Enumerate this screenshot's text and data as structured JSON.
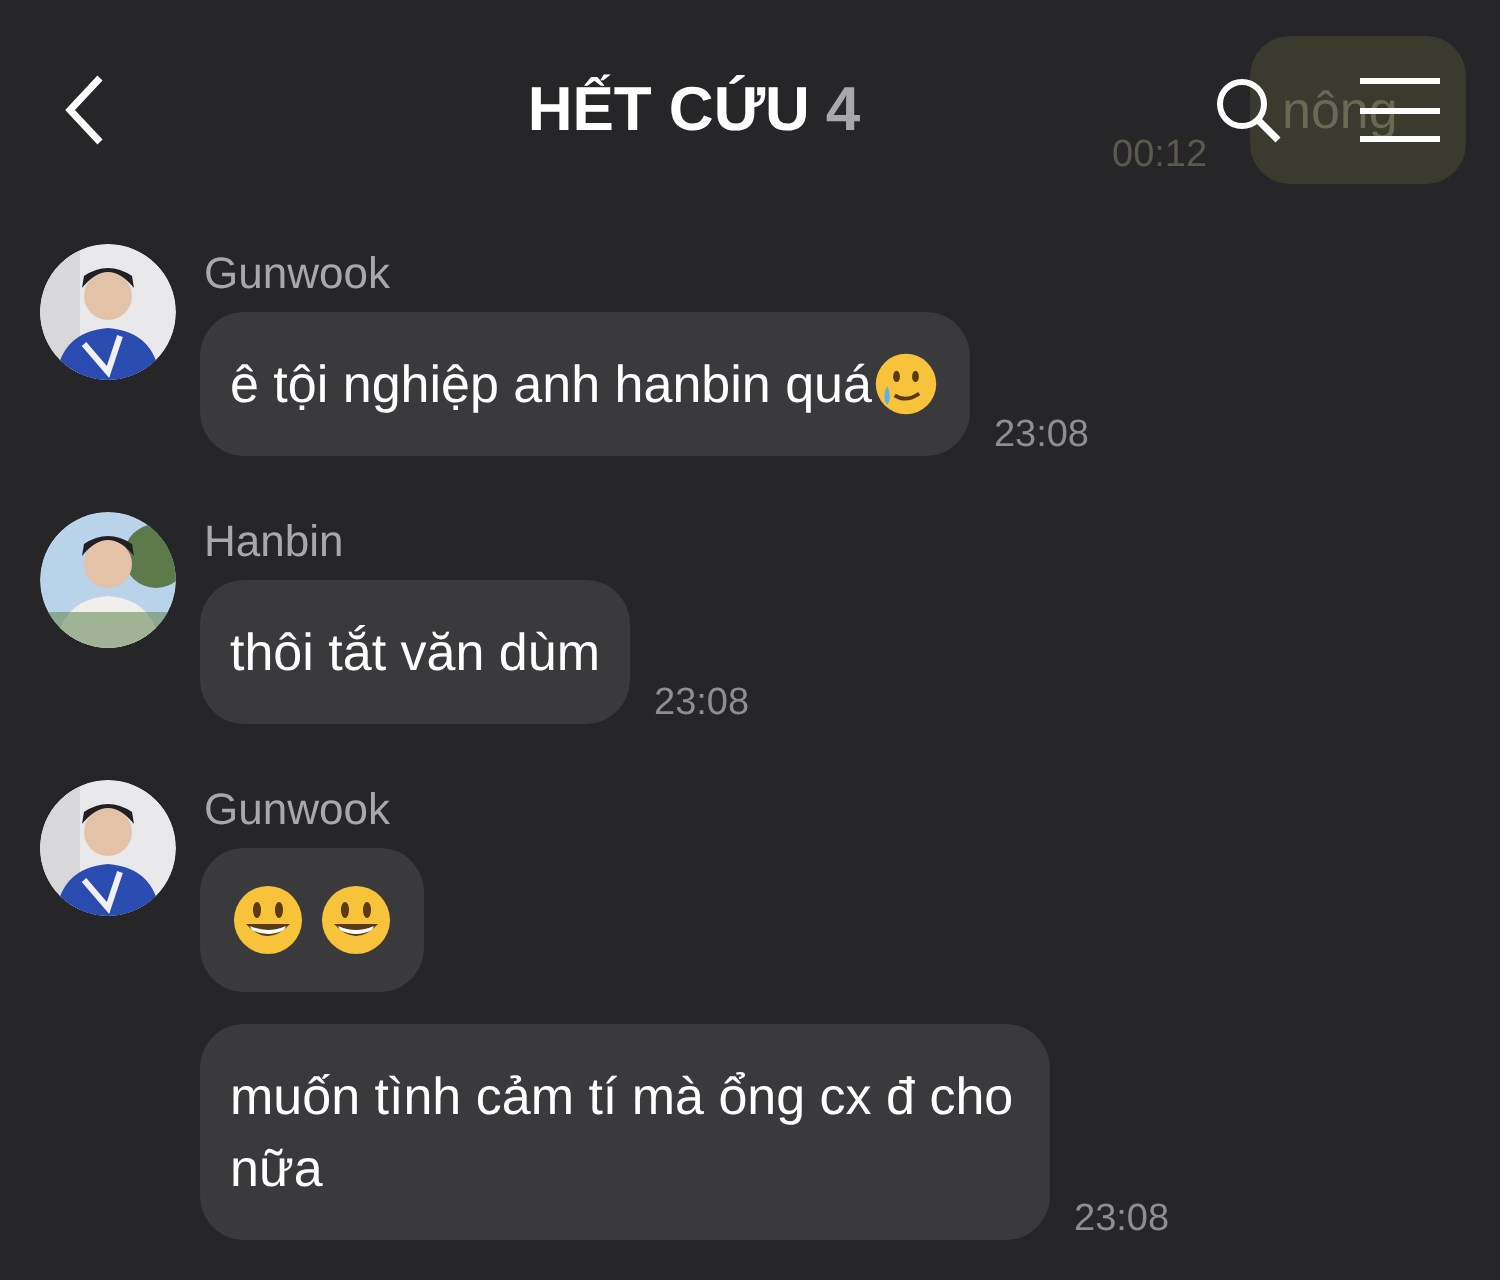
{
  "header": {
    "title": "HẾT CỨU",
    "member_count": "4"
  },
  "faded_message": {
    "text": "nông",
    "time": "00:12"
  },
  "groups": [
    {
      "name": "Gunwook",
      "avatar": {
        "kind": "picture"
      },
      "messages": [
        {
          "kind": "text",
          "text": "ê tội nghiệp anh hanbin quá",
          "icons": [
            {
              "kind": "tear"
            }
          ],
          "time": "23:08"
        }
      ]
    },
    {
      "name": "Hanbin",
      "avatar": {
        "kind": "picture"
      },
      "messages": [
        {
          "kind": "text",
          "text": "thôi tắt văn dùm",
          "time": "23:08"
        }
      ]
    },
    {
      "name": "Gunwook",
      "avatar": {
        "kind": "picture"
      },
      "messages": [
        {
          "kind": "emoji",
          "icons": [
            {
              "kind": "grin"
            },
            {
              "kind": "grin"
            }
          ]
        },
        {
          "kind": "text",
          "text": "muốn tình cảm tí mà ổng cx đ cho nữa",
          "time": "23:08"
        }
      ]
    }
  ]
}
